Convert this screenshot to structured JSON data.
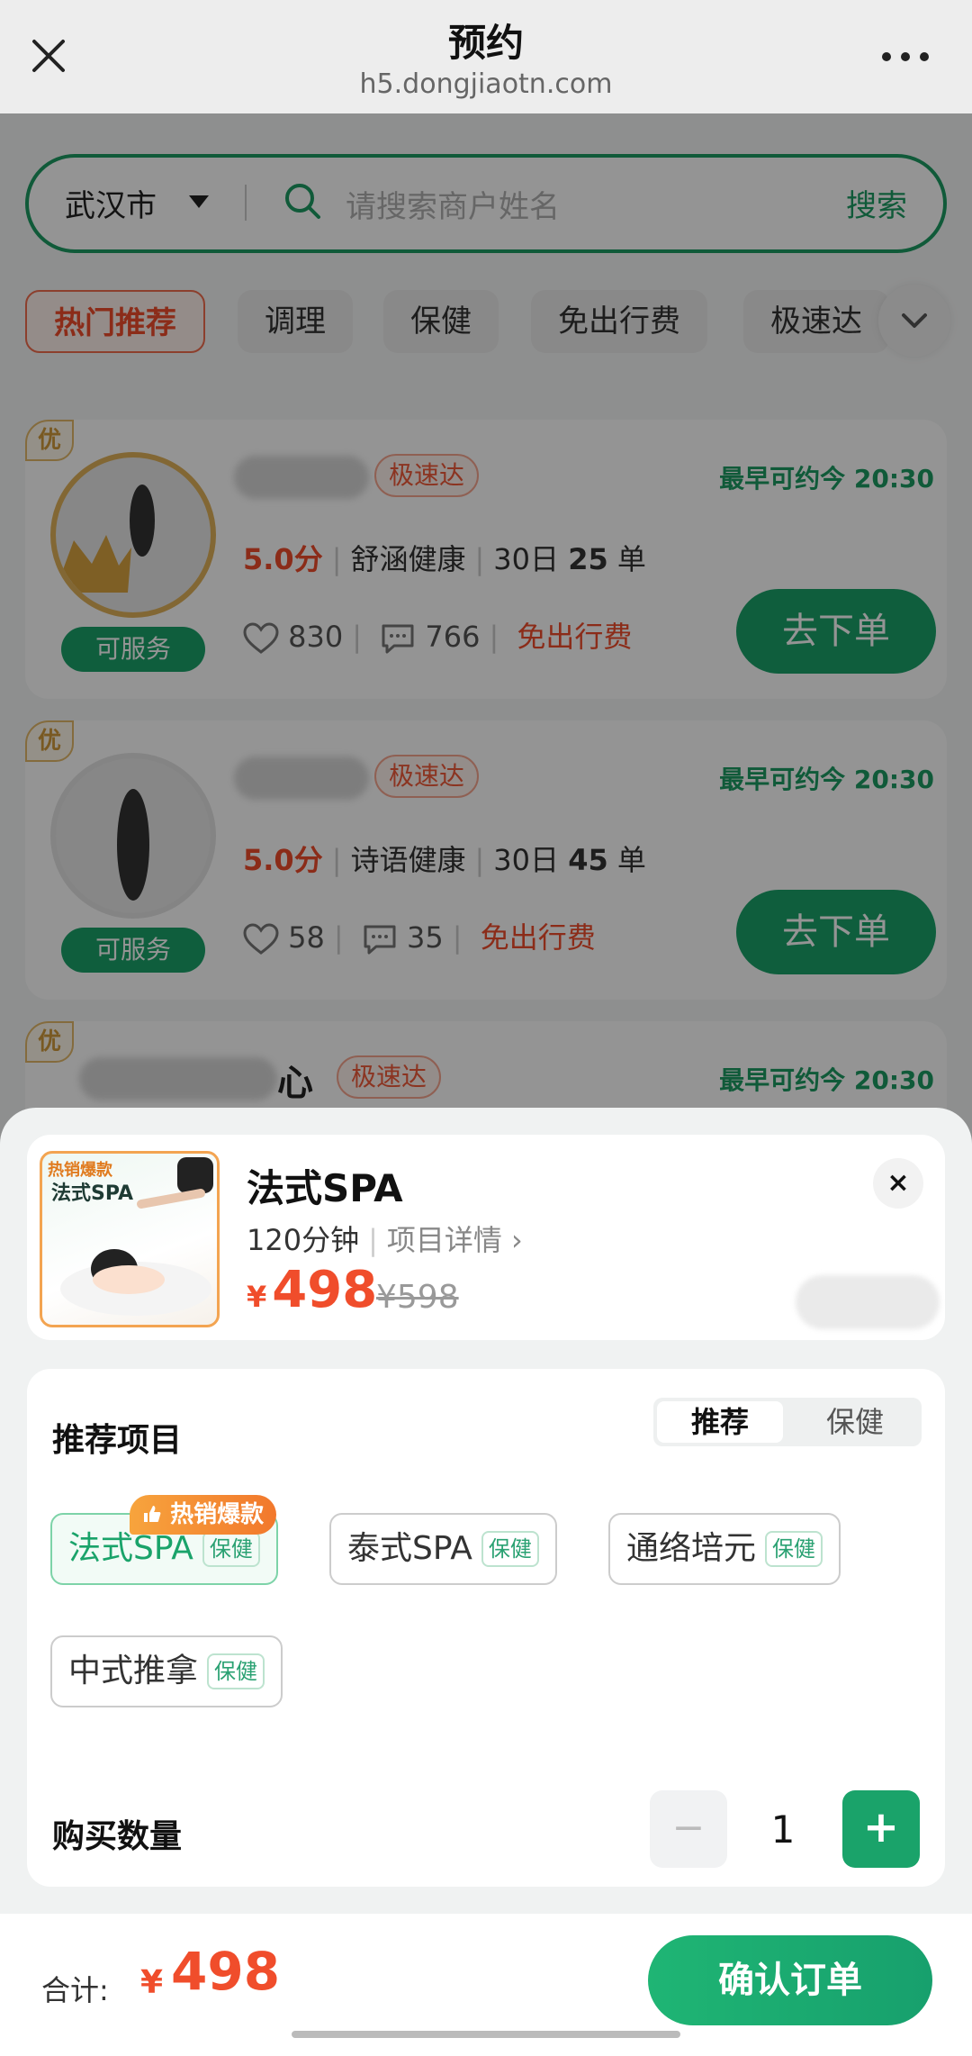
{
  "header": {
    "title": "预约",
    "url": "h5.dongjiaotn.com"
  },
  "search": {
    "city": "武汉市",
    "placeholder": "请搜索商户姓名",
    "button": "搜索"
  },
  "categories": [
    "热门推荐",
    "调理",
    "保健",
    "免出行费",
    "极速达"
  ],
  "cards": [
    {
      "you": "优",
      "name": "",
      "badge": "极速达",
      "earliest": "最早可约今 20:30",
      "score": "5.0分",
      "shop": "舒涵健康",
      "orders_prefix": "30日",
      "orders": "25",
      "orders_suffix": "单",
      "likes": "830",
      "comments": "766",
      "free": "免出行费",
      "status": "可服务",
      "order_btn": "去下单"
    },
    {
      "you": "优",
      "name": "",
      "badge": "极速达",
      "earliest": "最早可约今 20:30",
      "score": "5.0分",
      "shop": "诗语健康",
      "orders_prefix": "30日",
      "orders": "45",
      "orders_suffix": "单",
      "likes": "58",
      "comments": "35",
      "free": "免出行费",
      "status": "可服务",
      "order_btn": "去下单"
    },
    {
      "you": "优",
      "name": "心",
      "badge": "极速达",
      "earliest": "最早可约今 20:30"
    }
  ],
  "product": {
    "image_hot": "热销爆款",
    "image_title": "法式SPA",
    "name": "法式SPA",
    "duration": "120分钟",
    "detail_link": "项目详情 ›",
    "currency": "¥",
    "price": "498",
    "original_price": "¥598",
    "close": "×"
  },
  "projects": {
    "heading": "推荐项目",
    "tabs": [
      "推荐",
      "保健"
    ],
    "hot_flag": "热销爆款",
    "items": [
      {
        "name": "法式SPA",
        "tag": "保健"
      },
      {
        "name": "泰式SPA",
        "tag": "保健"
      },
      {
        "name": "通络培元",
        "tag": "保健"
      },
      {
        "name": "中式推拿",
        "tag": "保健"
      }
    ],
    "qty_label": "购买数量",
    "qty": "1",
    "minus": "−",
    "plus": "+"
  },
  "footer": {
    "total_label": "合计:",
    "currency": "¥",
    "total": "498",
    "confirm": "确认订单"
  },
  "colors": {
    "accent": "#1aa36a",
    "price": "#f04d2b"
  }
}
